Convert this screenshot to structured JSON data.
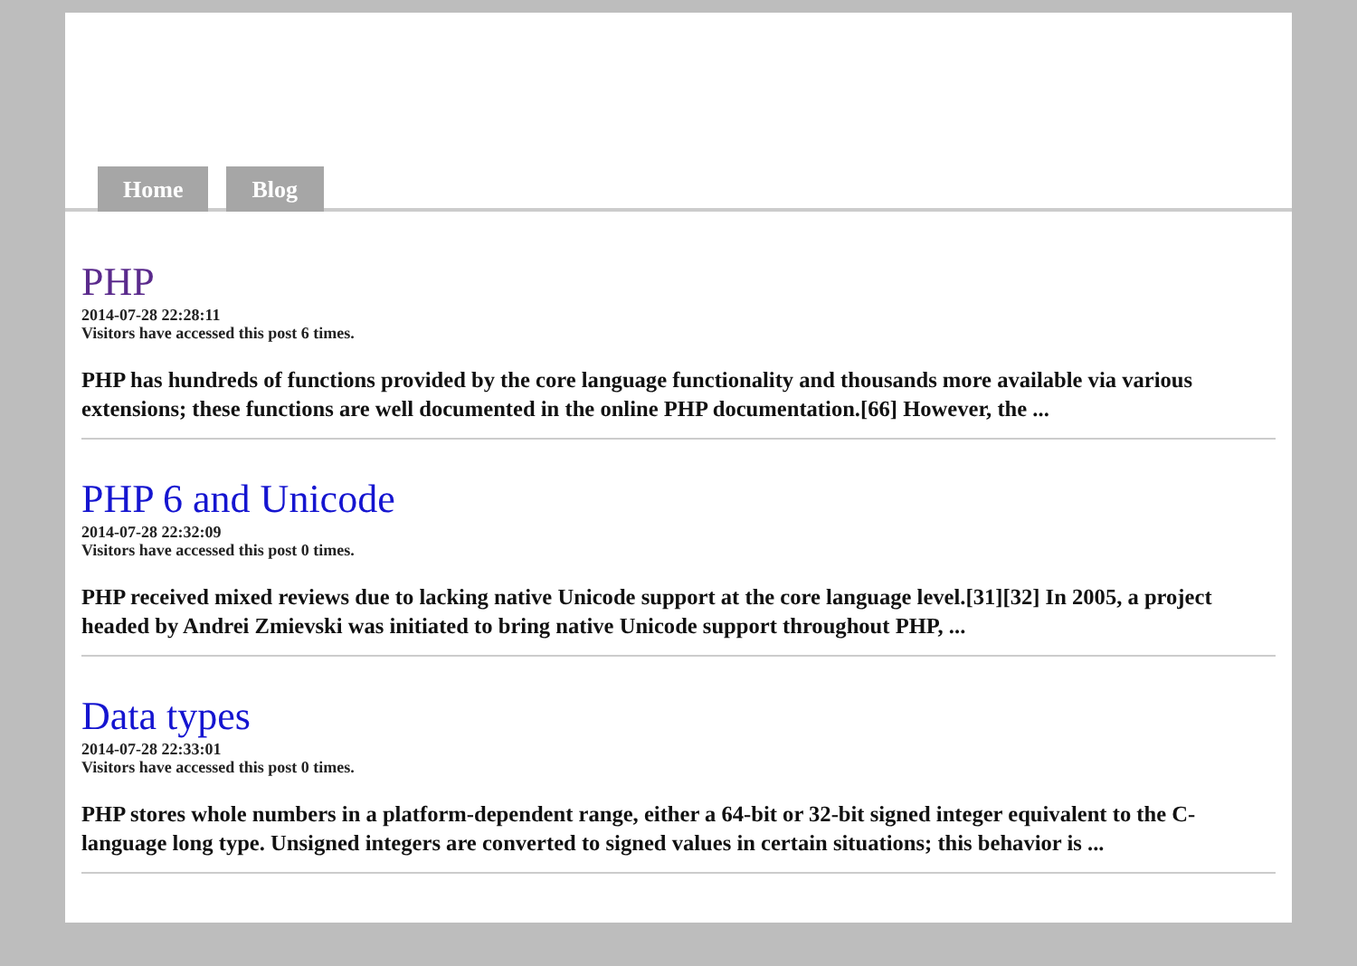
{
  "nav": [
    {
      "label": "Home"
    },
    {
      "label": "Blog"
    }
  ],
  "posts": [
    {
      "title": "PHP",
      "visited": true,
      "date": "2014-07-28 22:28:11",
      "visits": "Visitors have accessed this post 6 times.",
      "excerpt": "PHP has hundreds of functions provided by the core language functionality and thousands more available via various extensions; these functions are well documented in the online PHP documentation.[66] However, the ..."
    },
    {
      "title": "PHP 6 and Unicode",
      "visited": false,
      "date": "2014-07-28 22:32:09",
      "visits": "Visitors have accessed this post 0 times.",
      "excerpt": "PHP received mixed reviews due to lacking native Unicode support at the core language level.[31][32] In 2005, a project headed by Andrei Zmievski was initiated to bring native Unicode support throughout PHP, ..."
    },
    {
      "title": "Data types",
      "visited": false,
      "date": "2014-07-28 22:33:01",
      "visits": "Visitors have accessed this post 0 times.",
      "excerpt": "PHP stores whole numbers in a platform-dependent range, either a 64-bit or 32-bit signed integer equivalent to the C-language long type. Unsigned integers are converted to signed values in certain situations; this behavior is ..."
    }
  ]
}
